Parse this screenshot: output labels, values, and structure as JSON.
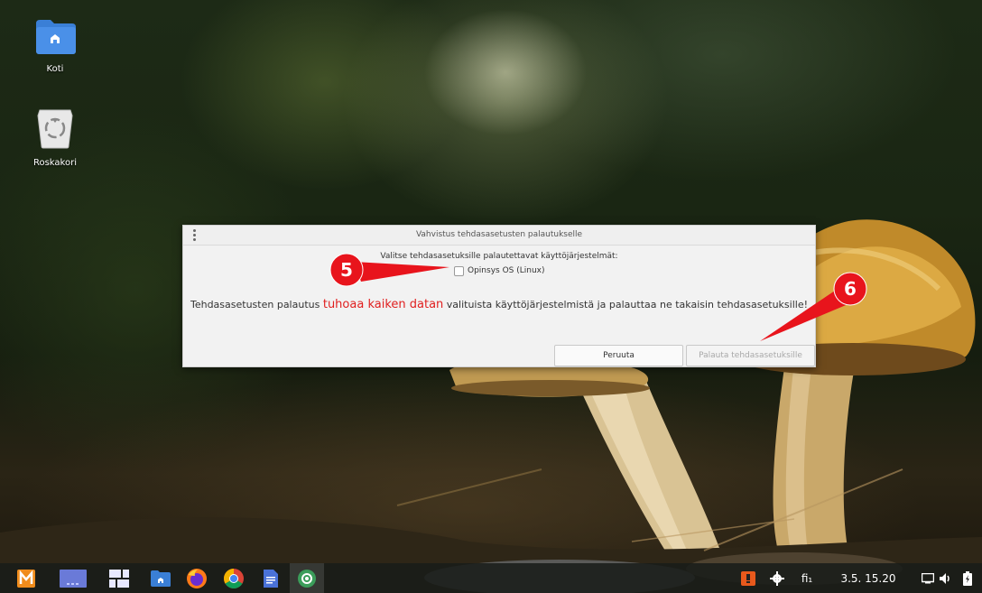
{
  "desktop": {
    "icons": [
      {
        "label": "Koti"
      },
      {
        "label": "Roskakori"
      }
    ]
  },
  "dialog": {
    "title": "Vahvistus tehdasasetusten palautukselle",
    "prompt": "Valitse tehdasasetuksille palautettavat käyttöjärjestelmät:",
    "option_label": "Opinsys OS (Linux)",
    "option_checked": false,
    "warning_before": "Tehdasasetusten palautus ",
    "warning_highlight": "tuhoaa kaiken datan",
    "warning_after": " valituista käyttöjärjestelmistä ja palauttaa ne takaisin tehdasasetuksille!",
    "cancel_label": "Peruuta",
    "reset_label": "Palauta tehdasasetuksille",
    "danger_color": "#e02020"
  },
  "annotations": [
    {
      "number": "5",
      "color": "#e8141c"
    },
    {
      "number": "6",
      "color": "#e8141c"
    }
  ],
  "taskbar": {
    "apps": [
      "menu-app",
      "desktop-switcher",
      "window-overview",
      "file-manager",
      "firefox",
      "chrome",
      "text-editor",
      "screenshot-tool"
    ],
    "keyboard_layout": "fi₁",
    "clock": "3.5. 15.20"
  }
}
